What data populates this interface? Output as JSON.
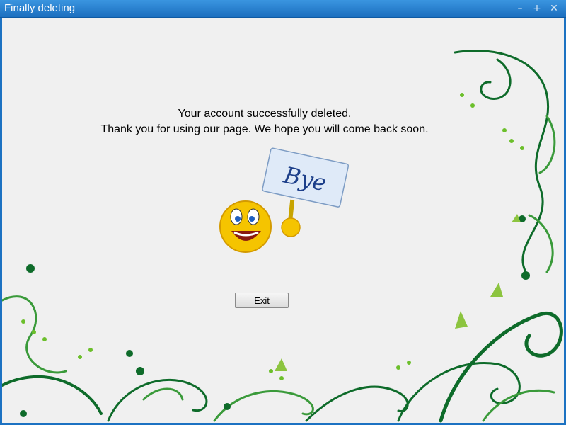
{
  "window": {
    "title": "Finally deleting",
    "controls": {
      "minimize": "–",
      "maximize": "+",
      "close": "✕"
    },
    "accent_color": "#1c72c2"
  },
  "content": {
    "line1": "Your account successfully deleted.",
    "line2": "Thank you for using our page. We hope you will come back soon.",
    "sign_text": "Bye",
    "exit_label": "Exit"
  },
  "decoration": {
    "theme": "green floral swirl border",
    "colors": [
      "#0e6b2a",
      "#6cbf2c",
      "#a8d86a"
    ]
  }
}
